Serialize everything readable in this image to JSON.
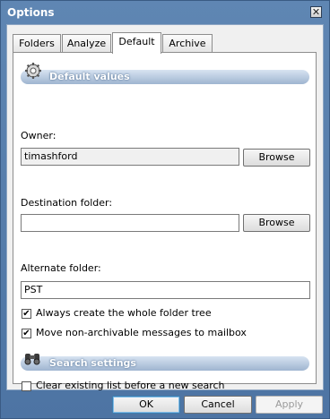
{
  "window": {
    "title": "Options",
    "close_glyph": "✕"
  },
  "tabs": [
    {
      "label": "Folders"
    },
    {
      "label": "Analyze"
    },
    {
      "label": "Default",
      "active": true
    },
    {
      "label": "Archive"
    }
  ],
  "default_values": {
    "header": "Default values",
    "header_icon": "gear-icon",
    "owner": {
      "label": "Owner:",
      "value": "timashford",
      "browse_label": "Browse"
    },
    "destination": {
      "label": "Destination folder:",
      "value": "",
      "browse_label": "Browse"
    },
    "alternate": {
      "label": "Alternate folder:",
      "value": "PST"
    },
    "options": [
      {
        "label": "Always create the whole folder tree",
        "checked": true
      },
      {
        "label": "Move non-archivable messages to mailbox",
        "checked": true
      }
    ]
  },
  "search_settings": {
    "header": "Search settings",
    "header_icon": "binoculars-icon",
    "options": [
      {
        "label": "Clear existing list before a new search",
        "checked": false
      }
    ]
  },
  "buttons": {
    "ok": "OK",
    "cancel": "Cancel",
    "apply": "Apply"
  },
  "check_glyph": "✔",
  "colors": {
    "title_bar": "#5f86b3",
    "header_pill": "#9fb5d0"
  }
}
